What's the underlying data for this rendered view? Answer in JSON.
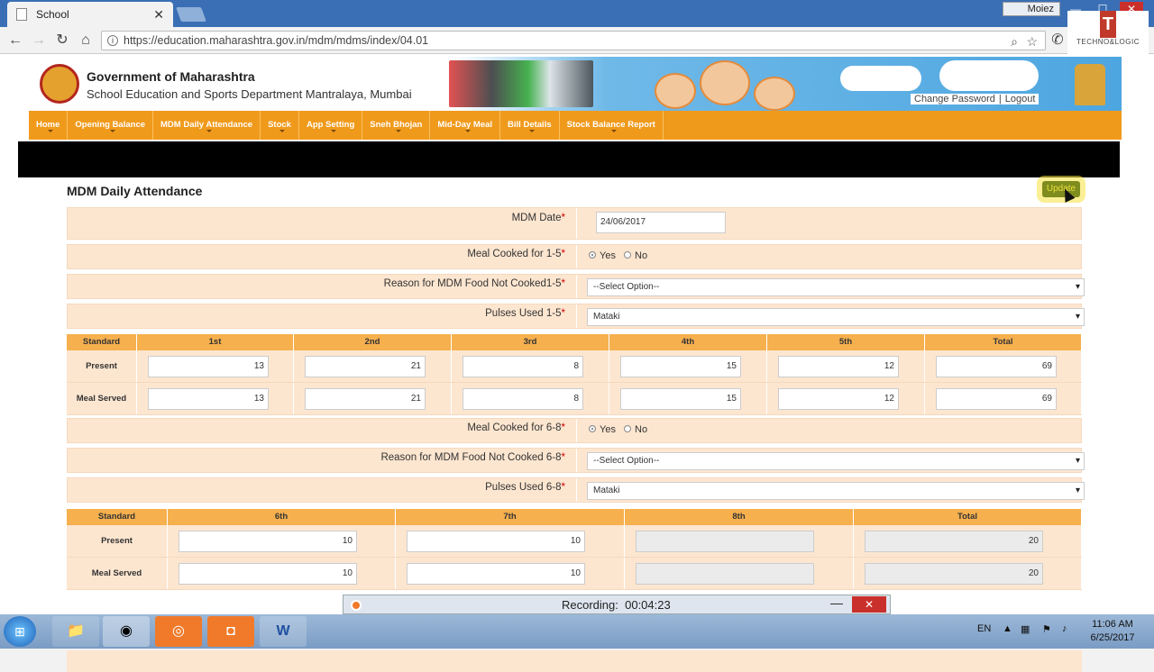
{
  "browser": {
    "tab_title": "School",
    "tab_close": "✕",
    "window_user": "Moiez",
    "url": "https://education.maharashtra.gov.in/mdm/mdms/index/04.01",
    "controls": {
      "minimize": "—",
      "maximize": "☐",
      "close": "✕"
    },
    "logo_text": "TECHNO&LOGIC",
    "logo_mark": "T"
  },
  "site": {
    "gov_title": "Government of Maharashtra",
    "dept_title": "School Education and Sports Department Mantralaya, Mumbai",
    "change_password": "Change Password",
    "logout": "Logout",
    "menu": [
      "Home",
      "Opening Balance",
      "MDM Daily Attendance",
      "Stock",
      "App Setting",
      "Sneh Bhojan",
      "Mid-Day Meal",
      "Bill Details",
      "Stock Balance Report"
    ]
  },
  "form": {
    "title": "MDM Daily Attendance",
    "update_label": "Update",
    "required_mark": "*",
    "mdm_date_label": "MDM Date",
    "mdm_date_value": "24/06/2017",
    "meal_cooked_1_5_label": "Meal Cooked for 1-5",
    "reason_1_5_label": "Reason for MDM Food Not Cooked1-5",
    "reason_1_5_value": "--Select Option--",
    "pulses_1_5_label": "Pulses Used 1-5",
    "pulses_1_5_value": "Mataki",
    "meal_cooked_6_8_label": "Meal Cooked for 6-8",
    "reason_6_8_label": "Reason for MDM Food Not Cooked 6-8",
    "reason_6_8_value": "--Select Option--",
    "pulses_6_8_label": "Pulses Used 6-8",
    "pulses_6_8_value": "Mataki",
    "yes": "Yes",
    "no": "No",
    "meal_cooked_1_5": "Yes",
    "meal_cooked_6_8": "Yes"
  },
  "table_1_5": {
    "headers": [
      "Standard",
      "1st",
      "2nd",
      "3rd",
      "4th",
      "5th",
      "Total"
    ],
    "present_label": "Present",
    "meal_served_label": "Meal Served",
    "present": [
      "13",
      "21",
      "8",
      "15",
      "12",
      "69"
    ],
    "meal_served": [
      "13",
      "21",
      "8",
      "15",
      "12",
      "69"
    ]
  },
  "table_6_8": {
    "headers": [
      "Standard",
      "6th",
      "7th",
      "8th",
      "Total"
    ],
    "present_label": "Present",
    "meal_served_label": "Meal Served",
    "present": [
      "10",
      "10",
      "",
      "20"
    ],
    "meal_served": [
      "10",
      "10",
      "",
      "20"
    ]
  },
  "recorder": {
    "label": "Recording:",
    "time": "00:04:23",
    "minimize": "—",
    "close": "✕"
  },
  "taskbar": {
    "lang": "EN",
    "time": "11:06 AM",
    "date": "6/25/2017"
  }
}
